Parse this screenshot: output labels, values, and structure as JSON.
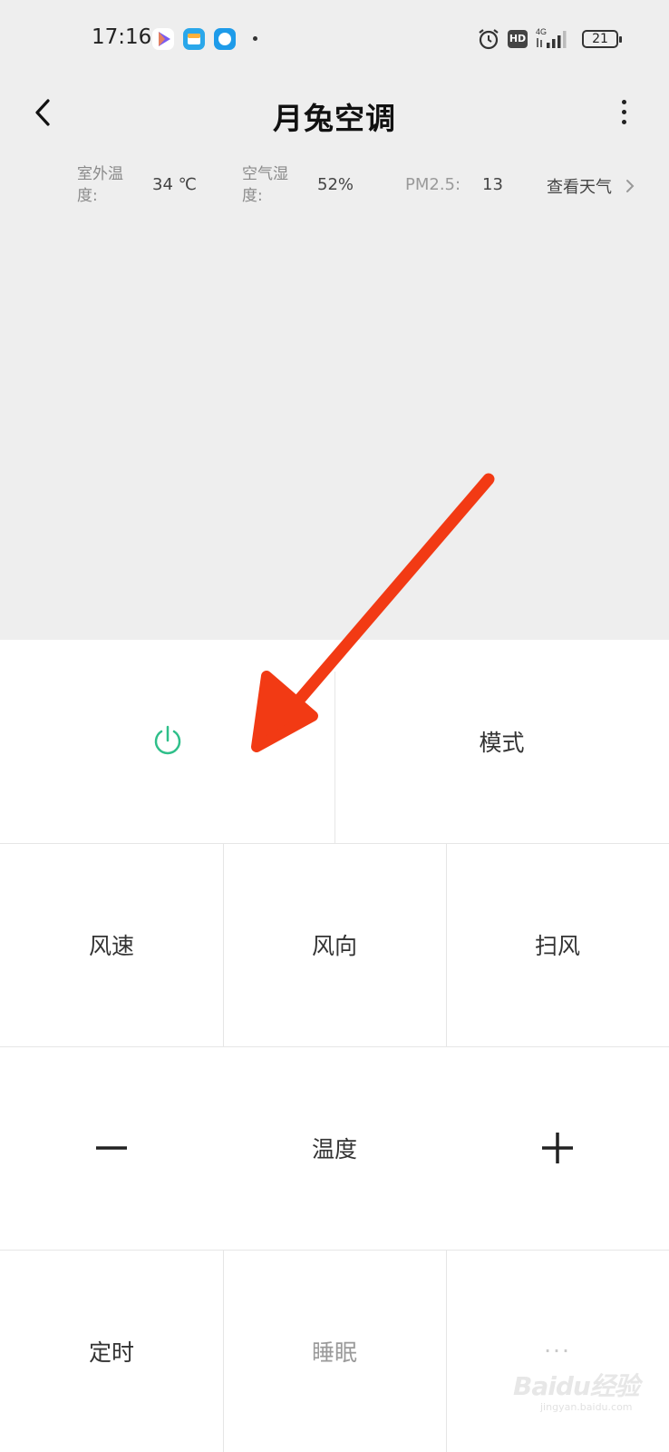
{
  "status_bar": {
    "time": "17:16",
    "network": "4G",
    "hd": "HD",
    "battery": "21"
  },
  "header": {
    "title": "月兔空调"
  },
  "weather": {
    "outdoor_temp_label": "室外温度:",
    "outdoor_temp_value": "34 ℃",
    "humidity_label": "空气湿度:",
    "humidity_value": "52%",
    "pm25_label": "PM2.5:",
    "pm25_value": "13",
    "view_weather": "查看天气"
  },
  "controls": {
    "mode": "模式",
    "wind_speed": "风速",
    "wind_direction": "风向",
    "swing": "扫风",
    "temperature": "温度",
    "timer": "定时",
    "sleep": "睡眠",
    "more": "···"
  },
  "watermark": {
    "logo": "Baidu经验",
    "url": "jingyan.baidu.com"
  },
  "colors": {
    "power_icon": "#2fbf8a",
    "arrow": "#f23a14",
    "top_background": "#eeeeee"
  }
}
